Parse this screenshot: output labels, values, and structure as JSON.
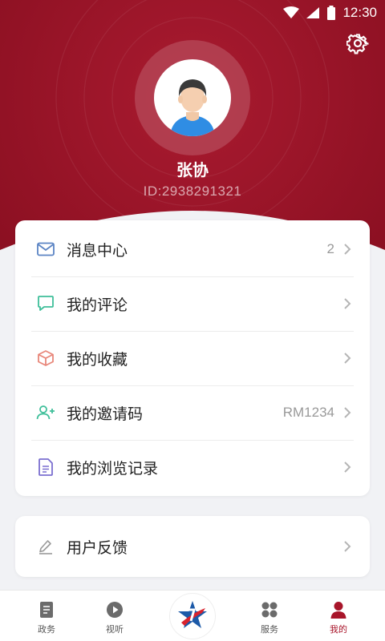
{
  "status_bar": {
    "time": "12:30"
  },
  "profile": {
    "name": "张协",
    "id_text": "ID:2938291321"
  },
  "menu": [
    {
      "label": "消息中心",
      "value": "2",
      "icon": "mail-icon",
      "icon_color": "#5b84c4"
    },
    {
      "label": "我的评论",
      "value": "",
      "icon": "comment-icon",
      "icon_color": "#3fbf9a"
    },
    {
      "label": "我的收藏",
      "value": "",
      "icon": "box-icon",
      "icon_color": "#e8877a"
    },
    {
      "label": "我的邀请码",
      "value": "RM1234",
      "icon": "add-user-icon",
      "icon_color": "#3fbf9a"
    },
    {
      "label": "我的浏览记录",
      "value": "",
      "icon": "document-icon",
      "icon_color": "#7b6fd0"
    }
  ],
  "feedback": {
    "label": "用户反馈",
    "icon": "pencil-icon"
  },
  "bottom_nav": [
    {
      "label": "政务",
      "icon": "document-icon",
      "active": false
    },
    {
      "label": "视听",
      "icon": "play-icon",
      "active": false
    },
    {
      "label": "",
      "icon": "center-logo-icon",
      "active": false
    },
    {
      "label": "服务",
      "icon": "grid-icon",
      "active": false
    },
    {
      "label": "我的",
      "icon": "person-icon",
      "active": true
    }
  ],
  "colors": {
    "brand": "#a8152a",
    "header_dark": "#8e1022",
    "accent_text": "#a8152a"
  }
}
